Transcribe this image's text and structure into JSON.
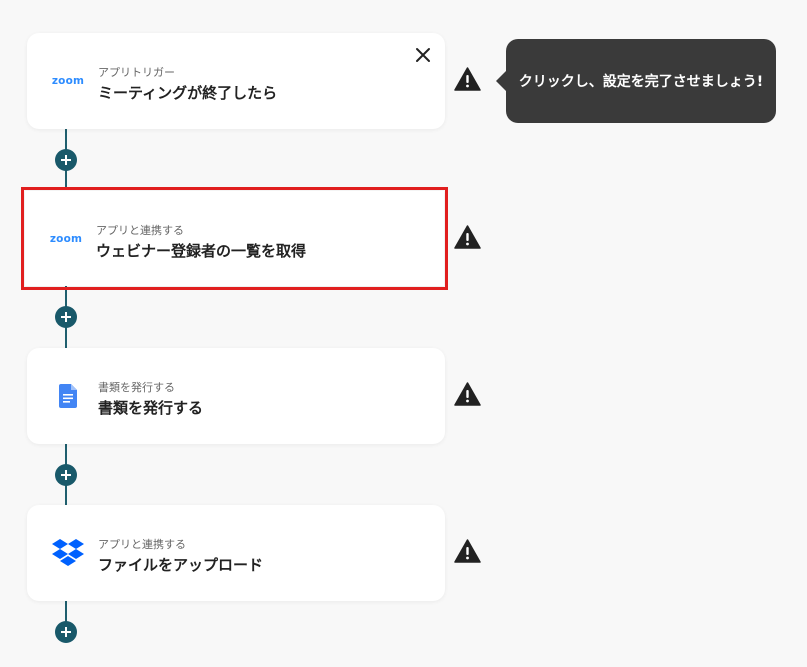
{
  "flow": {
    "steps": [
      {
        "sub": "アプリトリガー",
        "title": "ミーティングが終了したら",
        "logo": "zoom",
        "logo_text": "zoom"
      },
      {
        "sub": "アプリと連携する",
        "title": "ウェビナー登録者の一覧を取得",
        "logo": "zoom",
        "logo_text": "zoom"
      },
      {
        "sub": "書類を発行する",
        "title": "書類を発行する",
        "logo": "google-docs"
      },
      {
        "sub": "アプリと連携する",
        "title": "ファイルをアップロード",
        "logo": "dropbox"
      }
    ]
  },
  "tooltip": {
    "text": "クリックし、設定を完了させましょう!"
  },
  "colors": {
    "accent": "#19596a",
    "highlight": "#e11f1f",
    "zoom": "#2d8cff",
    "docs": "#4285f4",
    "dropbox": "#0061fe",
    "warning": "#222222",
    "tooltip_bg": "#3a3a3a"
  }
}
